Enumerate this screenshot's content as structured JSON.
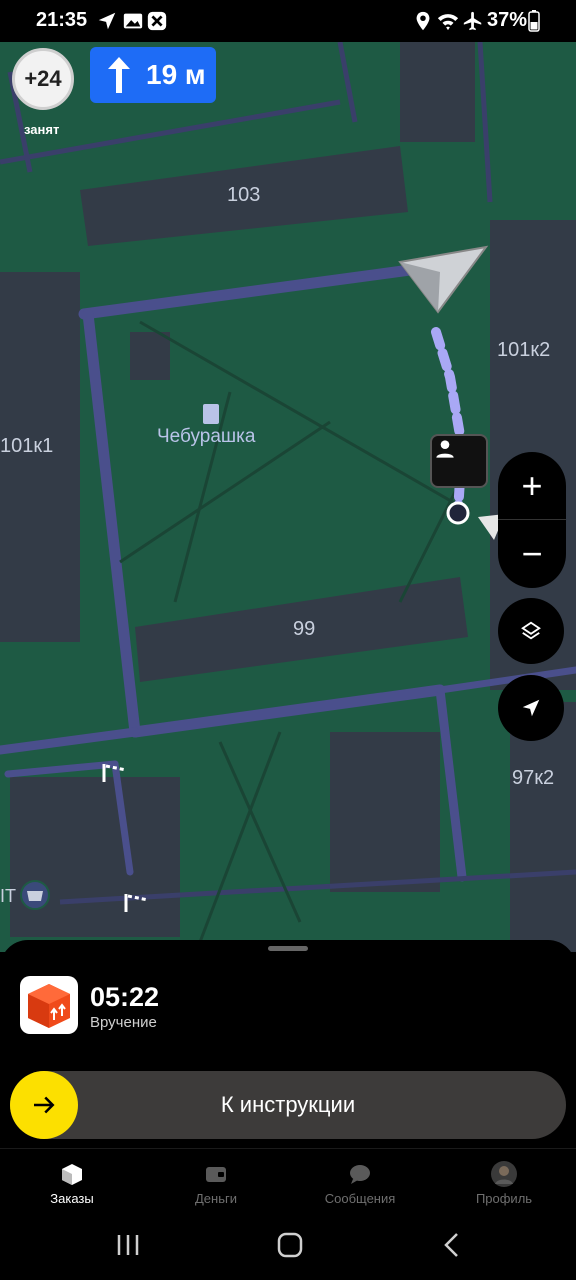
{
  "status_bar": {
    "time": "21:35",
    "battery": "37%",
    "left_icons": [
      "navigation-arrow-icon",
      "gallery-icon",
      "x-box-icon"
    ],
    "right_icons": [
      "location-icon",
      "wifi-icon",
      "airplane-icon",
      "battery-icon"
    ]
  },
  "map": {
    "buildings": [
      "103",
      "101к2",
      "101к1",
      "99",
      "97к2"
    ],
    "poi": "Чебурашка",
    "partial_label": "IT"
  },
  "top": {
    "busy_count": "+24",
    "busy_label": "занят",
    "maneuver_distance": "19 м",
    "maneuver_icon": "arrow-up-icon",
    "maneuver_color": "#1e6cf6"
  },
  "controls": {
    "zoom_in": "+",
    "zoom_out": "−"
  },
  "sheet": {
    "timer": "05:22",
    "timer_label": "Вручение",
    "slider_text": "К инструкции",
    "accent": "#fce000"
  },
  "tabs": [
    {
      "label": "Заказы",
      "icon": "box-icon",
      "active": true
    },
    {
      "label": "Деньги",
      "icon": "wallet-icon",
      "active": false
    },
    {
      "label": "Сообщения",
      "icon": "chat-icon",
      "active": false
    },
    {
      "label": "Профиль",
      "icon": "avatar-icon",
      "active": false
    }
  ]
}
